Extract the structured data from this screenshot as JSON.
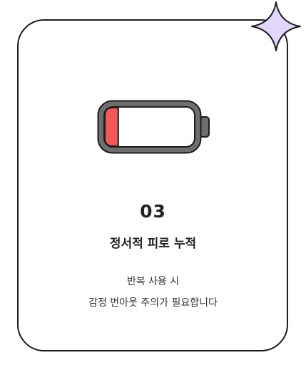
{
  "card": {
    "number": "03",
    "title": "정서적 피로 누적",
    "description_lines": [
      "반복 사용 시",
      "감정 번아웃 주의가 필요합니다"
    ]
  },
  "battery": {
    "charge_fraction": 0.15,
    "fill_color": "#f25a5a",
    "body_color": "#6e6e6e"
  },
  "sparkle": {
    "icon": "four-point-star-icon",
    "color": "#e3d6fb"
  }
}
